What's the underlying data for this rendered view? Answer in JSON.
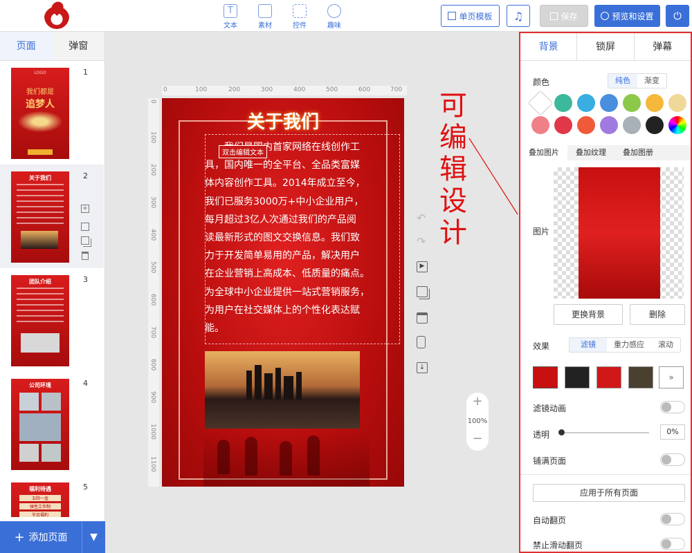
{
  "toolbar": {
    "tools": [
      {
        "label": "文本",
        "icon": "text-icon"
      },
      {
        "label": "素材",
        "icon": "image-icon"
      },
      {
        "label": "控件",
        "icon": "widget-icon"
      },
      {
        "label": "趣味",
        "icon": "bulb-icon"
      }
    ],
    "template_btn": "单页模板",
    "music_icon": "music-icon",
    "save_btn": "保存",
    "preview_btn": "预览和设置",
    "power_icon": "power-icon"
  },
  "left": {
    "tabs": [
      "页面",
      "弹窗"
    ],
    "pages": [
      {
        "num": "1",
        "title": "我们都是",
        "subtitle": "追梦人",
        "logo": "LOGO"
      },
      {
        "num": "2",
        "title": "关于我们"
      },
      {
        "num": "3",
        "title": "团队介绍"
      },
      {
        "num": "4",
        "title": "公司环境"
      },
      {
        "num": "5",
        "title": "福利待遇",
        "items": [
          "五险一金",
          "弹性工作制",
          "节日福利"
        ]
      }
    ],
    "add_page": "添加页面"
  },
  "canvas": {
    "ruler_h": [
      "0",
      "100",
      "200",
      "300",
      "400",
      "500",
      "600",
      "700"
    ],
    "ruler_v": [
      "0",
      "100",
      "200",
      "300",
      "400",
      "500",
      "600",
      "700",
      "800",
      "900",
      "1000",
      "1100"
    ],
    "page_title": "关于我们",
    "text_lines": [
      "　　我们是国内首家网络在线创作工",
      "具，国内唯一的全平台、全品类富媒",
      "体内容创作工具。2014年成立至今，",
      "我们已服务3000万+中小企业用户，",
      "每月超过3亿人次通过我们的产品阅",
      "读最新形式的图文交换信息。我们致",
      "力于开发简单易用的产品，解决用户",
      "在企业营销上高成本、低质量的痛点。",
      "为全球中小企业提供一站式营销服务，",
      "为用户在社交媒体上的个性化表达赋",
      "能。"
    ],
    "edit_tag": "双击编辑文本",
    "zoom": "100%",
    "annotation": "可编辑设计"
  },
  "right": {
    "tabs": [
      "背景",
      "锁屏",
      "弹幕"
    ],
    "color_label": "颜色",
    "color_modes": [
      "纯色",
      "渐变"
    ],
    "swatches": [
      "#ffffff",
      "#3cb89a",
      "#3aaee0",
      "#4a8ee0",
      "#8cc84a",
      "#f5b83a",
      "#f0d898",
      "#f08088",
      "#e03848",
      "#f05a3a",
      "#a07ae0",
      "#a8b0b8",
      "#222222",
      "rainbow"
    ],
    "overlay_tabs": [
      "叠加图片",
      "叠加纹理",
      "叠加图册"
    ],
    "image_label": "图片",
    "replace_btn": "更换背景",
    "delete_btn": "删除",
    "effect_label": "效果",
    "effect_tabs": [
      "滤镜",
      "重力感应",
      "滚动"
    ],
    "filter_anim": "滤镜动画",
    "opacity_label": "透明",
    "opacity_value": "0%",
    "fill_page": "铺满页面",
    "apply_all": "应用于所有页面",
    "auto_flip": "自动翻页",
    "no_swipe": "禁止滑动翻页"
  }
}
